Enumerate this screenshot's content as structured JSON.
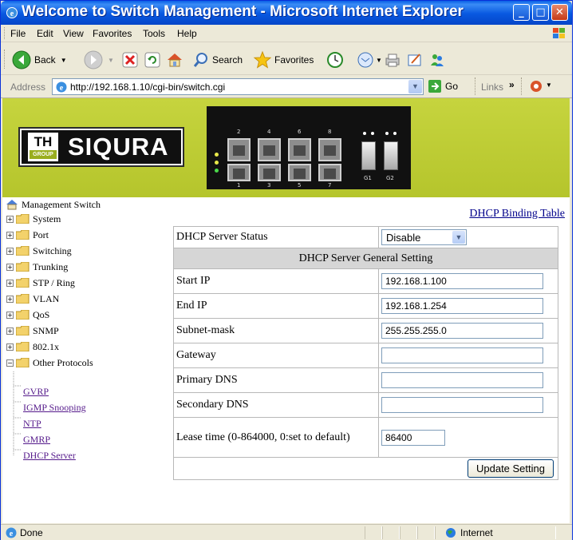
{
  "window": {
    "title": "Welcome to Switch Management - Microsoft Internet Explorer"
  },
  "menu": {
    "items": [
      "File",
      "Edit",
      "View",
      "Favorites",
      "Tools",
      "Help"
    ]
  },
  "toolbar": {
    "back": "Back",
    "search": "Search",
    "favorites": "Favorites"
  },
  "address": {
    "label": "Address",
    "url": "http://192.168.1.10/cgi-bin/switch.cgi",
    "go": "Go",
    "links": "Links"
  },
  "banner": {
    "logo_th": "TH",
    "logo_group": "GROUP",
    "logo_brand": "SIQURA",
    "port_numbers_top": [
      "2",
      "4",
      "6",
      "8"
    ],
    "port_numbers_bottom": [
      "1",
      "3",
      "5",
      "7"
    ],
    "sfp_numbers": [
      "G1",
      "G2"
    ]
  },
  "sidebar": {
    "root": "Management Switch",
    "items": [
      "System",
      "Port",
      "Switching",
      "Trunking",
      "STP / Ring",
      "VLAN",
      "QoS",
      "SNMP",
      "802.1x",
      "Other Protocols"
    ],
    "sub_items": [
      "GVRP",
      "IGMP Snooping",
      "NTP",
      "GMRP",
      "DHCP Server"
    ]
  },
  "main": {
    "binding_link": "DHCP Binding Table",
    "status_label": "DHCP Server Status",
    "status_value": "Disable",
    "section_header": "DHCP Server General Setting",
    "fields": [
      {
        "label": "Start IP",
        "value": "192.168.1.100"
      },
      {
        "label": "End IP",
        "value": "192.168.1.254"
      },
      {
        "label": "Subnet-mask",
        "value": "255.255.255.0"
      },
      {
        "label": "Gateway",
        "value": ""
      },
      {
        "label": "Primary DNS",
        "value": ""
      },
      {
        "label": "Secondary DNS",
        "value": ""
      }
    ],
    "lease_label": "Lease time (0-864000, 0:set to default)",
    "lease_value": "86400",
    "update_button": "Update Setting"
  },
  "status": {
    "text": "Done",
    "zone": "Internet"
  }
}
